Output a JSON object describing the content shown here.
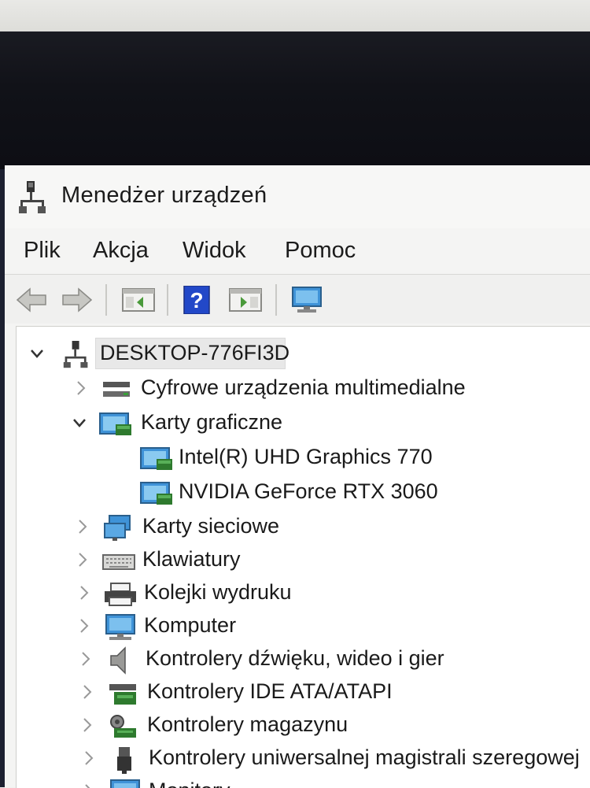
{
  "window": {
    "title": "Menedżer urządzeń"
  },
  "menu": [
    "Plik",
    "Akcja",
    "Widok",
    "Pomoc"
  ],
  "toolbar": {
    "buttons": [
      "back-arrow-icon",
      "forward-arrow-icon",
      "properties-icon",
      "help-icon",
      "driver-icon",
      "monitor-icon"
    ]
  },
  "tree": {
    "root": "DESKTOP-776FI3D",
    "items": [
      {
        "label": "Cyfrowe urządzenia multimedialne",
        "expanded": false
      },
      {
        "label": "Karty graficzne",
        "expanded": true
      },
      {
        "label": "Intel(R) UHD Graphics 770",
        "child": true
      },
      {
        "label": "NVIDIA GeForce RTX 3060",
        "child": true
      },
      {
        "label": "Karty sieciowe",
        "expanded": false
      },
      {
        "label": "Klawiatury",
        "expanded": false
      },
      {
        "label": "Kolejki wydruku",
        "expanded": false
      },
      {
        "label": "Komputer",
        "expanded": false
      },
      {
        "label": "Kontrolery dźwięku, wideo i gier",
        "expanded": false
      },
      {
        "label": "Kontrolery IDE ATA/ATAPI",
        "expanded": false
      },
      {
        "label": "Kontrolery magazynu",
        "expanded": false
      },
      {
        "label": "Kontrolery uniwersalnej magistrali szeregowej",
        "expanded": false
      },
      {
        "label": "Monitory",
        "expanded": false
      }
    ]
  },
  "colors": {
    "desktop": "#111218",
    "window_bg": "#f4f4f3",
    "tree_bg": "#ffffff",
    "accent_blue": "#2a7fd0"
  }
}
